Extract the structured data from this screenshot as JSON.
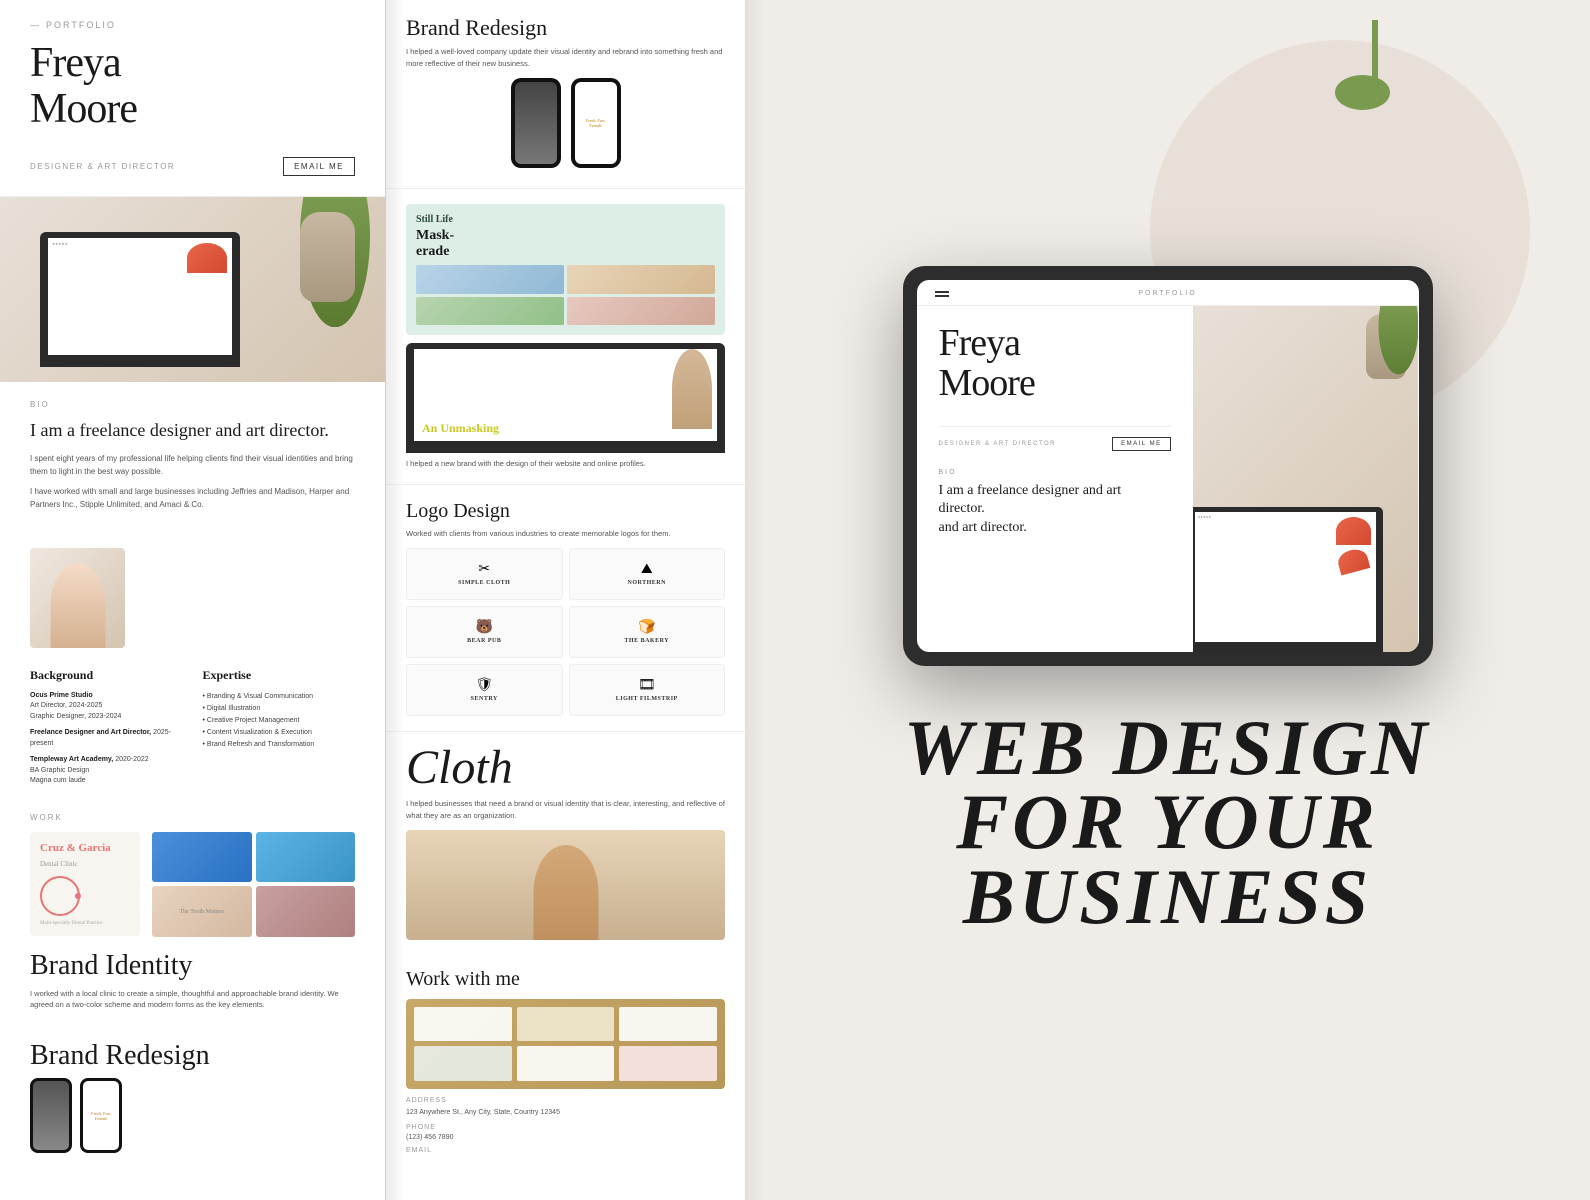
{
  "left": {
    "portfolio_label": "PORTFOLIO",
    "designer_name_line1": "Freya",
    "designer_name_line2": "Moore",
    "tagline": "DESIGNER & ART DIRECTOR",
    "email_button": "EMAIL ME",
    "bio_label": "BIO",
    "bio_headline": "I am a freelance designer and art director.",
    "bio_text1": "I spent eight years of my professional life helping clients find their visual identities and bring them to light in the best way possible.",
    "bio_text2": "I have worked with small and large businesses including Jeffries and Madison, Harper and Partners Inc., Stipple Unlimited, and Amaci & Co.",
    "background_title": "Background",
    "expertise_title": "Expertise",
    "bg_items": [
      {
        "company": "Ocus Prime Studio",
        "role": "Art Director, 2024-2025"
      },
      {
        "company": "Graphic Designer, 2023-2024",
        "role": ""
      },
      {
        "company": "Freelance Designer and Art Director,",
        "role": "2025-present"
      },
      {
        "company": "Templeway Art Academy,",
        "role": "2020-2022, BA Graphic Design, Magna cum laude"
      }
    ],
    "exp_items": [
      "Branding & Visual Communication",
      "Digital Illustration",
      "Creative Project Management",
      "Content Visualization & Execution",
      "Brand Refresh and Transformation"
    ],
    "work_label": "WORK",
    "dental_name": "Cruz & Garcia",
    "dental_subtitle": "Dental Clinic",
    "dental_tagline": "Multi-specialty Dental Practice",
    "work_title": "Brand Identity",
    "work_desc": "I worked with a local clinic to create a simple, thoughtful and approachable brand identity. We agreed on a two-color scheme and modern forms as the key elements.",
    "brand_redesign_title": "Brand Redesign",
    "brand_title2": "Brand"
  },
  "center": {
    "brand_redesign_title": "Brand Redesign",
    "brand_redesign_desc": "I helped a well-loved company update their visual identity and rebrand into something fresh and more reflective of their new business.",
    "still_life_title": "Still Life",
    "masquerade_word1": "Mask-",
    "masquerade_word2": "erade",
    "laptop_text": "An Unmasking",
    "laptop_desc": "I helped a new brand with the design of their website and online profiles.",
    "logo_design_title": "Logo Design",
    "logo_desc": "Worked with clients from various industries to create memorable logos for them.",
    "logos": [
      {
        "name": "SIMPLE CLOTH",
        "icon": "✂"
      },
      {
        "name": "NORTHERN",
        "icon": "⛰"
      },
      {
        "name": "BEAR PUB",
        "icon": "🐻"
      },
      {
        "name": "THE BAKERY",
        "icon": "🍞"
      },
      {
        "name": "SENTRY",
        "icon": "🛡"
      },
      {
        "name": "LIGHT FILMSTRIP",
        "icon": "🎞"
      }
    ],
    "cloth_title": "Cloth",
    "cloth_desc": "I helped businesses that need a brand or visual identity that is clear, interesting, and reflective of what they are as an organization.",
    "work_with_title": "Work with me",
    "address_label": "ADDRESS",
    "address": "123 Anywhere St., Any City, State, Country 12345",
    "phone_label": "PHONE",
    "phone": "(123) 456 7890",
    "email_label": "EMAIL"
  },
  "right": {
    "portfolio_label": "PORTFOLIO",
    "designer_name_line1": "Freya",
    "designer_name_line2": "Moore",
    "tagline": "DESIGNER & ART DIRECTOR",
    "email_button": "EMAIL ME",
    "bio_label": "BIO",
    "bio_text": "I am a freelance designer and art director.",
    "web_design_line1": "WEB DESIGN",
    "web_design_line2": "FOR YOUR BUSINESS"
  }
}
